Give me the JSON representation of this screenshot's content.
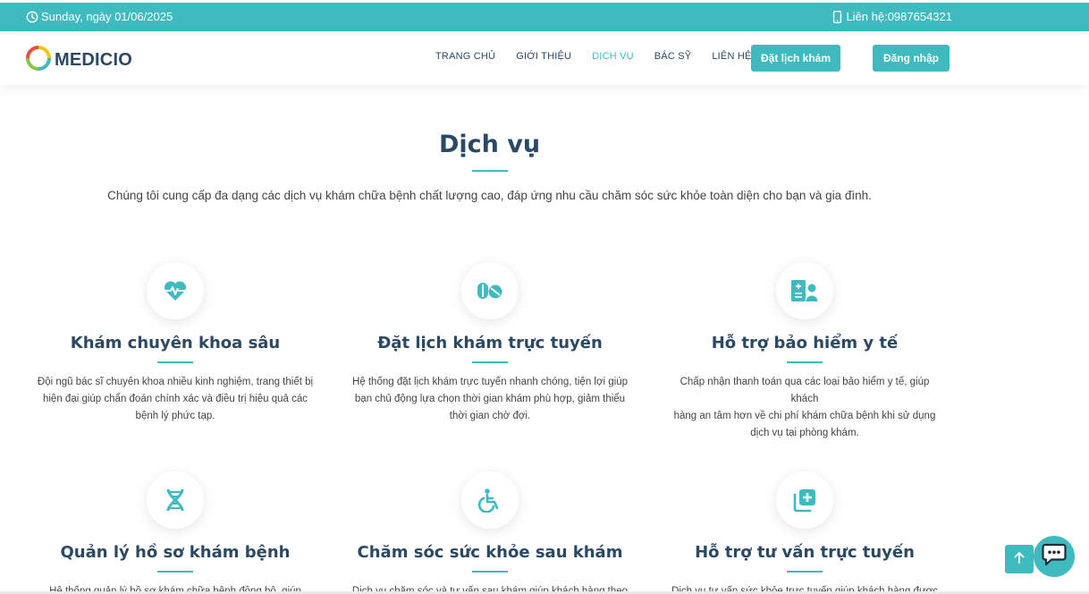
{
  "topbar": {
    "date_text": "Sunday, ngày 01/06/2025",
    "contact_text": "Liên hệ:0987654321"
  },
  "header": {
    "logo_text": "MEDICIO",
    "nav": [
      {
        "label": "TRANG CHỦ",
        "active": false
      },
      {
        "label": "GIỚI THIỆU",
        "active": false
      },
      {
        "label": "DỊCH VỤ",
        "active": true
      },
      {
        "label": "BÁC SỸ",
        "active": false
      },
      {
        "label": "LIÊN HỆ",
        "active": false
      }
    ],
    "book_label": "Đặt lịch khám",
    "login_label": "Đăng nhập"
  },
  "section": {
    "title": "Dịch vụ",
    "description": "Chúng tôi cung cấp đa dạng các dịch vụ khám chữa bệnh chất lượng cao, đáp ứng nhu cầu chăm sóc sức khỏe toàn diện cho bạn và gia đình."
  },
  "services": [
    {
      "icon": "heart-pulse-icon",
      "title": "Khám chuyên khoa sâu",
      "lines": [
        "Đội ngũ bác sĩ chuyên khoa nhiều kinh nghiệm, trang thiết bị",
        "hiện đại giúp chẩn đoán chính xác và điều trị hiệu quả các",
        "bệnh lý phức tạp."
      ]
    },
    {
      "icon": "pills-icon",
      "title": "Đặt lịch khám trực tuyến",
      "lines": [
        "Hệ thống đặt lịch khám trực tuyến nhanh chóng, tiện lợi giúp",
        "bạn chủ động lựa chọn thời gian khám phù hợp, giảm thiểu",
        "thời gian chờ đợi."
      ]
    },
    {
      "icon": "hospital-user-icon",
      "title": "Hỗ trợ bảo hiểm y tế",
      "lines": [
        "Chấp nhận thanh toán qua các loại bảo hiểm y tế, giúp khách",
        "hàng an tâm hơn về chi phí khám chữa bệnh khi sử dụng",
        "dịch vụ tại phòng khám."
      ]
    },
    {
      "icon": "dna-icon",
      "title": "Quản lý hồ sơ khám bệnh",
      "lines": [
        "Hệ thống quản lý hồ sơ khám chữa bệnh đồng bộ, giúp"
      ]
    },
    {
      "icon": "wheelchair-icon",
      "title": "Chăm sóc sức khỏe sau khám",
      "lines": [
        "Dịch vụ chăm sóc và tư vấn sau khám giúp khách hàng theo"
      ]
    },
    {
      "icon": "notes-medical-icon",
      "title": "Hỗ trợ tư vấn trực tuyến",
      "lines": [
        "Dịch vụ tư vấn sức khỏe trực tuyến giúp khách hàng được"
      ]
    }
  ],
  "colors": {
    "accent": "#3fbbc0",
    "heading": "#2c4964",
    "text": "#444444"
  }
}
